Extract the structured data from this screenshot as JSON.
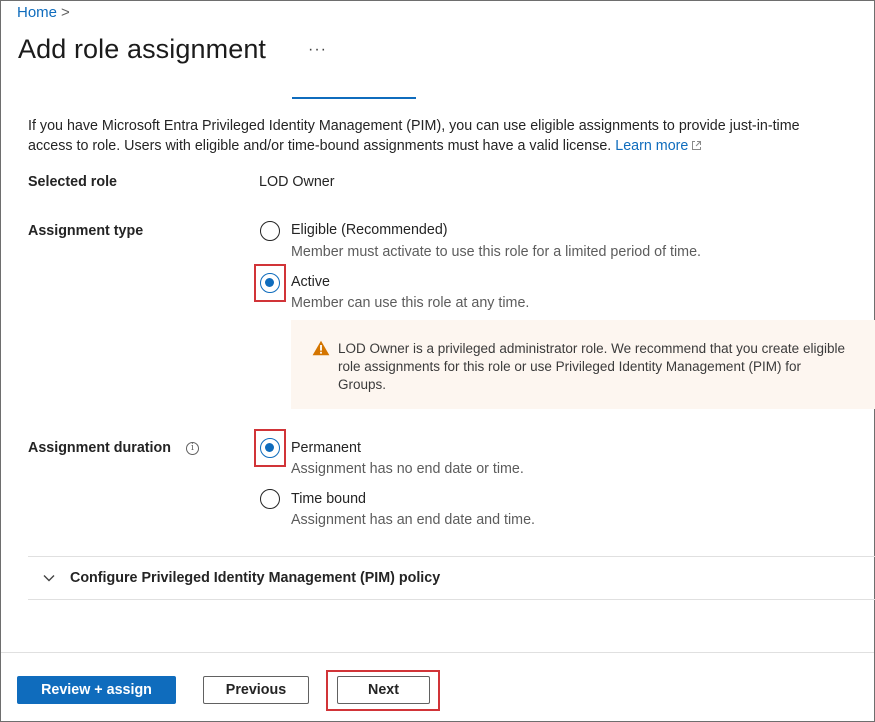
{
  "breadcrumb": {
    "home": "Home",
    "separator": ">"
  },
  "header": {
    "title": "Add role assignment",
    "more": "···"
  },
  "info": {
    "text": "If you have Microsoft Entra Privileged Identity Management (PIM), you can use eligible assignments to provide just-in-time access to role. Users with eligible and/or time-bound assignments must have a valid license.",
    "learn_more": "Learn more"
  },
  "selected_role": {
    "label": "Selected role",
    "value": "LOD Owner"
  },
  "assignment_type": {
    "label": "Assignment type",
    "options": [
      {
        "label": "Eligible (Recommended)",
        "description": "Member must activate to use this role for a limited period of time.",
        "selected": false
      },
      {
        "label": "Active",
        "description": "Member can use this role at any time.",
        "selected": true
      }
    ]
  },
  "warning": {
    "text": "LOD Owner is a privileged administrator role. We recommend that you create eligible role assignments for this role or use Privileged Identity Management (PIM) for Groups."
  },
  "assignment_duration": {
    "label": "Assignment duration",
    "info_icon": "i",
    "options": [
      {
        "label": "Permanent",
        "description": "Assignment has no end date or time.",
        "selected": true
      },
      {
        "label": "Time bound",
        "description": "Assignment has an end date and time.",
        "selected": false
      }
    ]
  },
  "pim_policy": {
    "label": "Configure Privileged Identity Management (PIM) policy",
    "expanded": false
  },
  "footer": {
    "review_assign": "Review + assign",
    "previous": "Previous",
    "next": "Next"
  },
  "colors": {
    "accent": "#0f6cbd",
    "highlight": "#d13438",
    "warning": "#d47500",
    "warning_bg": "#fdf6f0"
  }
}
